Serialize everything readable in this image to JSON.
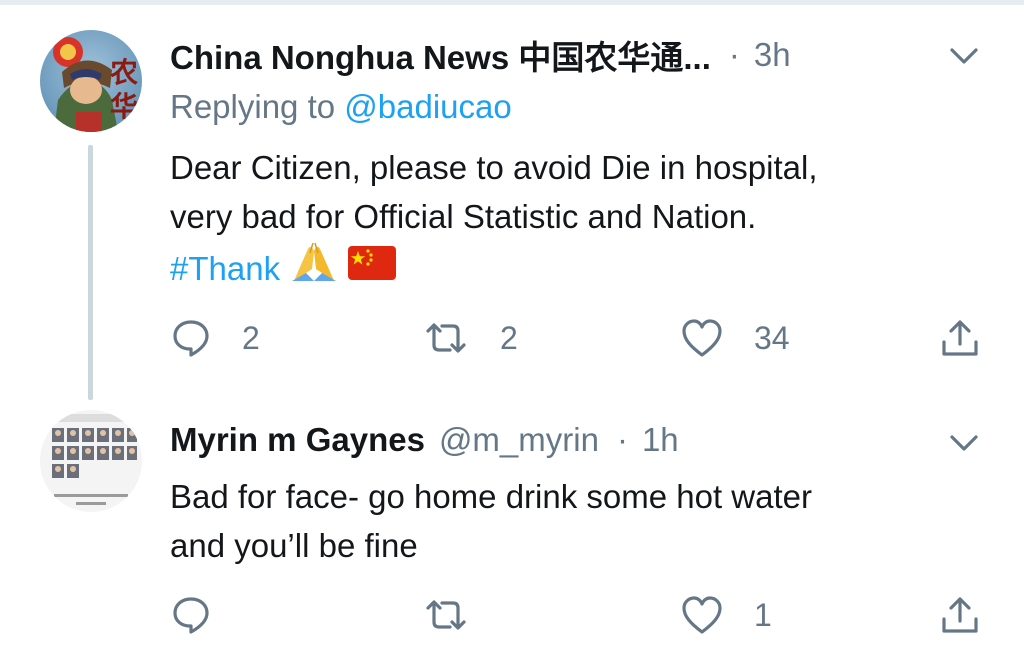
{
  "tweets": [
    {
      "display_name": "China Nonghua News 中国农华通...",
      "time": "3h",
      "replying_label": "Replying to",
      "replying_handle": "@badiucao",
      "body_line1": "Dear Citizen, please to avoid Die in hospital,",
      "body_line2": "very bad for Official Statistic and Nation.",
      "hashtag": "#Thank",
      "emojis": [
        "folded-hands",
        "china-flag"
      ],
      "replies": "2",
      "retweets": "2",
      "likes": "34",
      "avatar": "nonghua-avatar"
    },
    {
      "display_name": "Myrin m Gaynes",
      "handle": "@m_myrin",
      "time": "1h",
      "body_line1": "Bad for face- go home drink some hot water",
      "body_line2": "and you’ll be fine",
      "replies": "",
      "retweets": "",
      "likes": "1",
      "avatar": "portrait-grid-avatar"
    }
  ],
  "separator": "·",
  "colors": {
    "text": "#14171a",
    "secondary": "#657786",
    "link": "#1da1f2",
    "thread_line": "#ccd6dd"
  }
}
